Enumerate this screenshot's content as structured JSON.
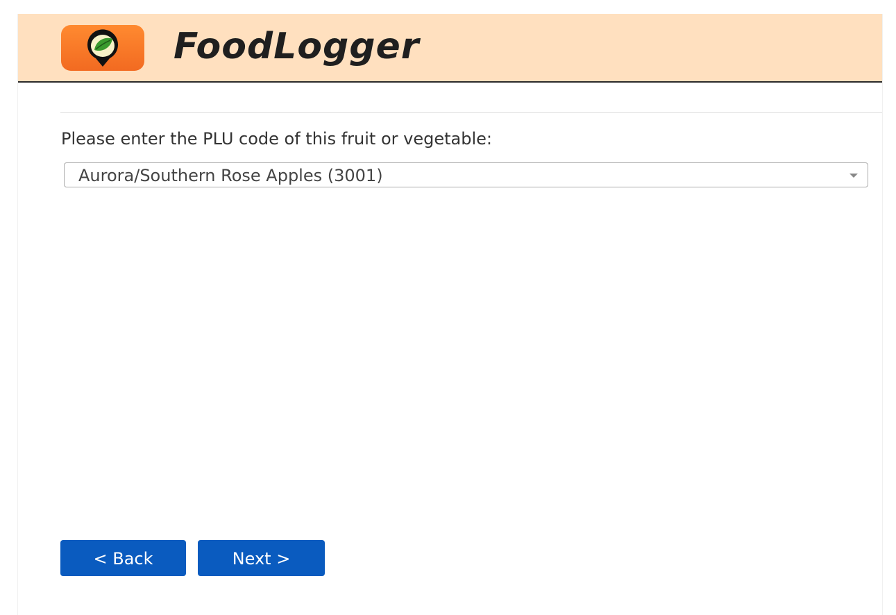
{
  "header": {
    "app_name": "FoodLogger",
    "logo_icon": "leaf-map-pin-icon",
    "background_color": "#ffe0bf"
  },
  "form": {
    "prompt": "Please enter the PLU code of this fruit or vegetable:",
    "plu_select": {
      "selected_value": "Aurora/Southern Rose Apples (3001)",
      "arrow_icon": "chevron-down-icon"
    }
  },
  "footer": {
    "back_label": "< Back",
    "next_label": "Next >",
    "button_color": "#0a5bbf"
  }
}
